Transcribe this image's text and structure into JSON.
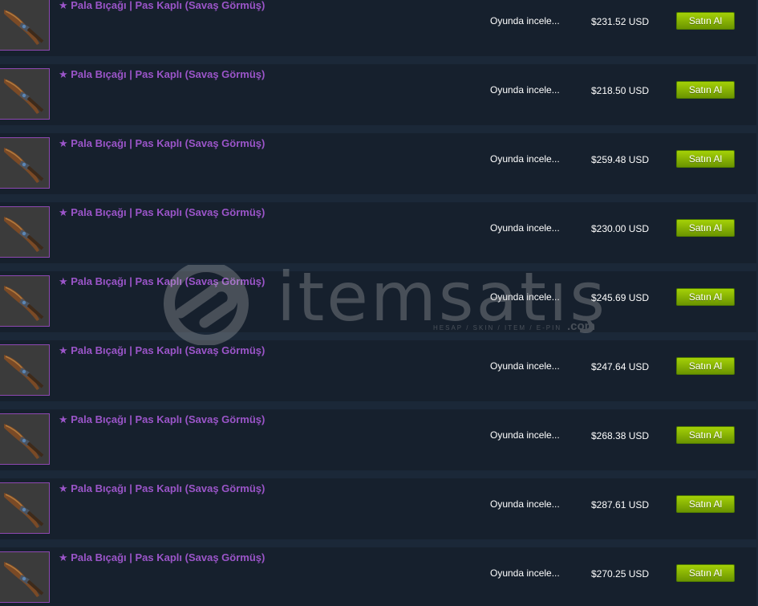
{
  "listings": [
    {
      "name": "★ Pala Bıçağı | Pas Kaplı (Savaş Görmüş)",
      "inspect": "Oyunda incele...",
      "price": "$231.52 USD",
      "buy": "Satın Al"
    },
    {
      "name": "★ Pala Bıçağı | Pas Kaplı (Savaş Görmüş)",
      "inspect": "Oyunda incele...",
      "price": "$218.50 USD",
      "buy": "Satın Al"
    },
    {
      "name": "★ Pala Bıçağı | Pas Kaplı (Savaş Görmüş)",
      "inspect": "Oyunda incele...",
      "price": "$259.48 USD",
      "buy": "Satın Al"
    },
    {
      "name": "★ Pala Bıçağı | Pas Kaplı (Savaş Görmüş)",
      "inspect": "Oyunda incele...",
      "price": "$230.00 USD",
      "buy": "Satın Al"
    },
    {
      "name": "★ Pala Bıçağı | Pas Kaplı (Savaş Görmüş)",
      "inspect": "Oyunda incele...",
      "price": "$245.69 USD",
      "buy": "Satın Al"
    },
    {
      "name": "★ Pala Bıçağı | Pas Kaplı (Savaş Görmüş)",
      "inspect": "Oyunda incele...",
      "price": "$247.64 USD",
      "buy": "Satın Al"
    },
    {
      "name": "★ Pala Bıçağı | Pas Kaplı (Savaş Görmüş)",
      "inspect": "Oyunda incele...",
      "price": "$268.38 USD",
      "buy": "Satın Al"
    },
    {
      "name": "★ Pala Bıçağı | Pas Kaplı (Savaş Görmüş)",
      "inspect": "Oyunda incele...",
      "price": "$287.61 USD",
      "buy": "Satın Al"
    },
    {
      "name": "★ Pala Bıçağı | Pas Kaplı (Savaş Görmüş)",
      "inspect": "Oyunda incele...",
      "price": "$270.25 USD",
      "buy": "Satın Al"
    }
  ],
  "watermark": {
    "brand": "itemsatış",
    "tagline": "HESAP / SKIN / ITEM / E-PIN",
    "domain": ".com"
  },
  "colors": {
    "background": "#1b2838",
    "row": "#16202d",
    "item_name": "#9b55c9",
    "buy_button": "#a4d007",
    "thumb_border": "#8e48b1"
  },
  "icons": {
    "item_image": "falchion-knife-icon",
    "watermark_logo": "itemsatis-logo-icon"
  }
}
